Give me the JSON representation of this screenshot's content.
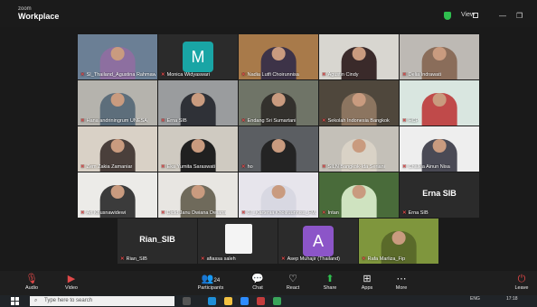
{
  "app": {
    "brand_small": "zoom",
    "brand_big": "Workplace",
    "view_label": "View"
  },
  "colors": {
    "mute": "#e04848",
    "share": "#2fbf4f",
    "leave": "#e04848"
  },
  "participants": [
    {
      "name": "SI_Thailand_Agustina Rahmawati",
      "kind": "video",
      "bg": "#6b7f95",
      "shirt": "#8d6fa0"
    },
    {
      "name": "Monica Widyaswari",
      "kind": "avatar",
      "letter": "M",
      "color": "#19a5a5"
    },
    {
      "name": "Nadia Lutfi Choirunnisa",
      "kind": "video",
      "bg": "#a87a4a",
      "shirt": "#3d3348"
    },
    {
      "name": "Agustin Cindy",
      "kind": "video",
      "bg": "#d8d6d0",
      "shirt": "#3a2a2a"
    },
    {
      "name": "Delia Indrawati",
      "kind": "video",
      "bg": "#bdb9b4",
      "shirt": "#8a6d5a"
    },
    {
      "name": "Hana andriningrum UNESA",
      "kind": "video",
      "bg": "#b5b3ad",
      "shirt": "#5d6e7b"
    },
    {
      "name": "Erna SIB",
      "kind": "video",
      "bg": "#9a9c9e",
      "shirt": "#2f3137"
    },
    {
      "name": "Endang Sri Sumartani",
      "kind": "video",
      "bg": "#6f7467",
      "shirt": "#33312d"
    },
    {
      "name": "Sekolah Indonesia Bangkok",
      "kind": "video",
      "bg": "#4f473c",
      "shirt": "#8c7560"
    },
    {
      "name": "HCP",
      "kind": "video",
      "bg": "#d9e6e0",
      "shirt": "#c04a4a"
    },
    {
      "name": "Zem Zakia Zamaniar",
      "kind": "video",
      "bg": "#d9d1c6",
      "shirt": "#4a3f3b"
    },
    {
      "name": "Eka Yumita Saraswati",
      "kind": "video",
      "bg": "#cfcac1",
      "shirt": "#202020"
    },
    {
      "name": "ho",
      "kind": "video",
      "bg": "#5b5e62",
      "shirt": "#242424"
    },
    {
      "name": "SILN Bangkok-Ida Seriani",
      "kind": "video",
      "bg": "#c4c0b8",
      "shirt": "#d9d2c6"
    },
    {
      "name": "Chalkia Ainun Nisa",
      "kind": "video",
      "bg": "#eeeeee",
      "shirt": "#4a4a55"
    },
    {
      "name": "Ari Khusnawidewi",
      "kind": "video",
      "bg": "#ecebe8",
      "shirt": "#3b3b3b"
    },
    {
      "name": "Didid Janu Dwiana Dwiana",
      "kind": "video",
      "bg": "#e8e6e2",
      "shirt": "#6f6a5b"
    },
    {
      "name": "07_Kartenia Kholifuunnisa_FM...",
      "kind": "video",
      "bg": "#e7e5ec",
      "shirt": "#d8d8e2"
    },
    {
      "name": "Intan",
      "kind": "video",
      "bg": "#496b3a",
      "shirt": "#cfe3c0"
    },
    {
      "name": "Erna SIB",
      "kind": "text",
      "display": "Erna SIB"
    },
    {
      "name": "Rian_SIB",
      "kind": "text",
      "display": "Rian_SIB"
    },
    {
      "name": "afiassa saleh",
      "kind": "blank"
    },
    {
      "name": "Asep Muhajir (Thailand)",
      "kind": "avatar",
      "letter": "A",
      "color": "#8c55c8"
    },
    {
      "name": "Rafa Marliza_Fip",
      "kind": "video",
      "bg": "#7f963d",
      "shirt": "#5a6a2a"
    }
  ],
  "toolbar": {
    "audio": "Audio",
    "video": "Video",
    "participants": "Participants",
    "participants_count": "24",
    "chat": "Chat",
    "react": "React",
    "share": "Share",
    "apps": "Apps",
    "more": "More",
    "leave": "Leave"
  },
  "taskbar": {
    "search_placeholder": "Type here to search",
    "lang": "ENG",
    "time": "17:18"
  }
}
